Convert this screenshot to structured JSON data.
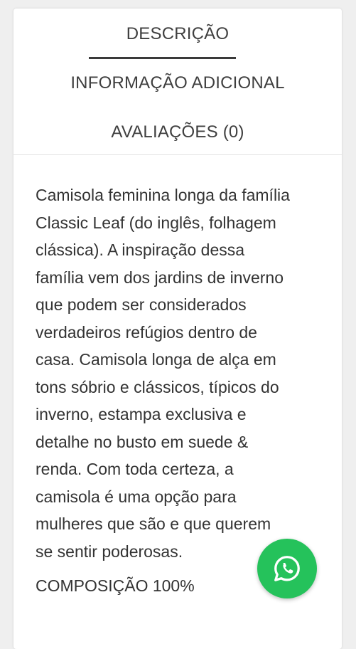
{
  "tabs": [
    {
      "label": "DESCRIÇÃO",
      "active": true
    },
    {
      "label": "INFORMAÇÃO ADICIONAL",
      "active": false
    },
    {
      "label": "AVALIAÇÕES (0)",
      "active": false
    }
  ],
  "description": {
    "paragraph": "Camisola feminina longa da família Classic Leaf (do inglês, folhagem clássica). A inspiração dessa família vem dos jardins de inverno que podem ser considerados verdadeiros refúgios dentro de casa. Camisola longa de alça em tons sóbrio e clássicos, típicos do inverno, estampa exclusiva e detalhe no busto em suede & renda. Com toda certeza, a camisola é uma opção para mulheres que são e que querem se sentir poderosas.",
    "composition": "COMPOSIÇÃO 100%"
  },
  "whatsapp": {
    "icon": "whatsapp-icon",
    "color": "#25c25b"
  }
}
